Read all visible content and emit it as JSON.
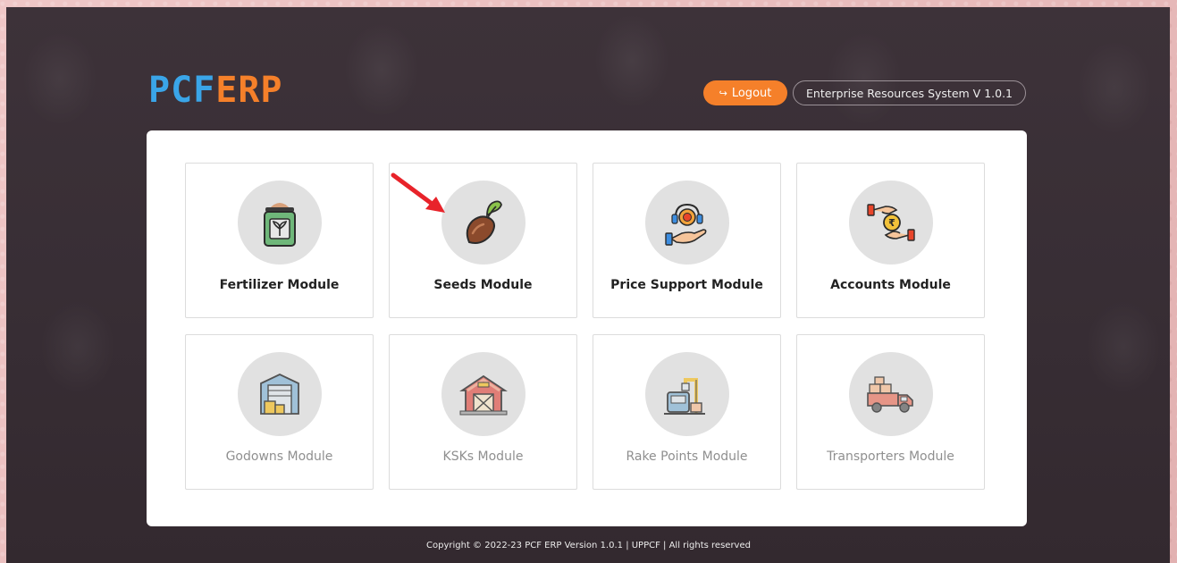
{
  "header": {
    "logo_pcf": "PCF",
    "logo_erp": "ERP",
    "logout_label": "Logout",
    "version_label": "Enterprise Resources System V 1.0.1"
  },
  "modules": [
    {
      "label": "Fertilizer Module",
      "icon": "fertilizer-bag-icon",
      "enabled": true
    },
    {
      "label": "Seeds Module",
      "icon": "seed-sprout-icon",
      "enabled": true
    },
    {
      "label": "Price Support Module",
      "icon": "price-support-icon",
      "enabled": true
    },
    {
      "label": "Accounts Module",
      "icon": "rupee-hands-icon",
      "enabled": true
    },
    {
      "label": "Godowns Module",
      "icon": "warehouse-icon",
      "enabled": false
    },
    {
      "label": "KSKs Module",
      "icon": "barn-icon",
      "enabled": false
    },
    {
      "label": "Rake Points Module",
      "icon": "train-crane-icon",
      "enabled": false
    },
    {
      "label": "Transporters Module",
      "icon": "truck-icon",
      "enabled": false
    }
  ],
  "footer": {
    "copyright": "Copyright © 2022-23 PCF ERP Version 1.0.1 | UPPCF | All rights reserved"
  },
  "colors": {
    "accent_orange": "#f5802a",
    "logo_blue": "#3aa5e8",
    "annotation_arrow": "#e8232a"
  }
}
